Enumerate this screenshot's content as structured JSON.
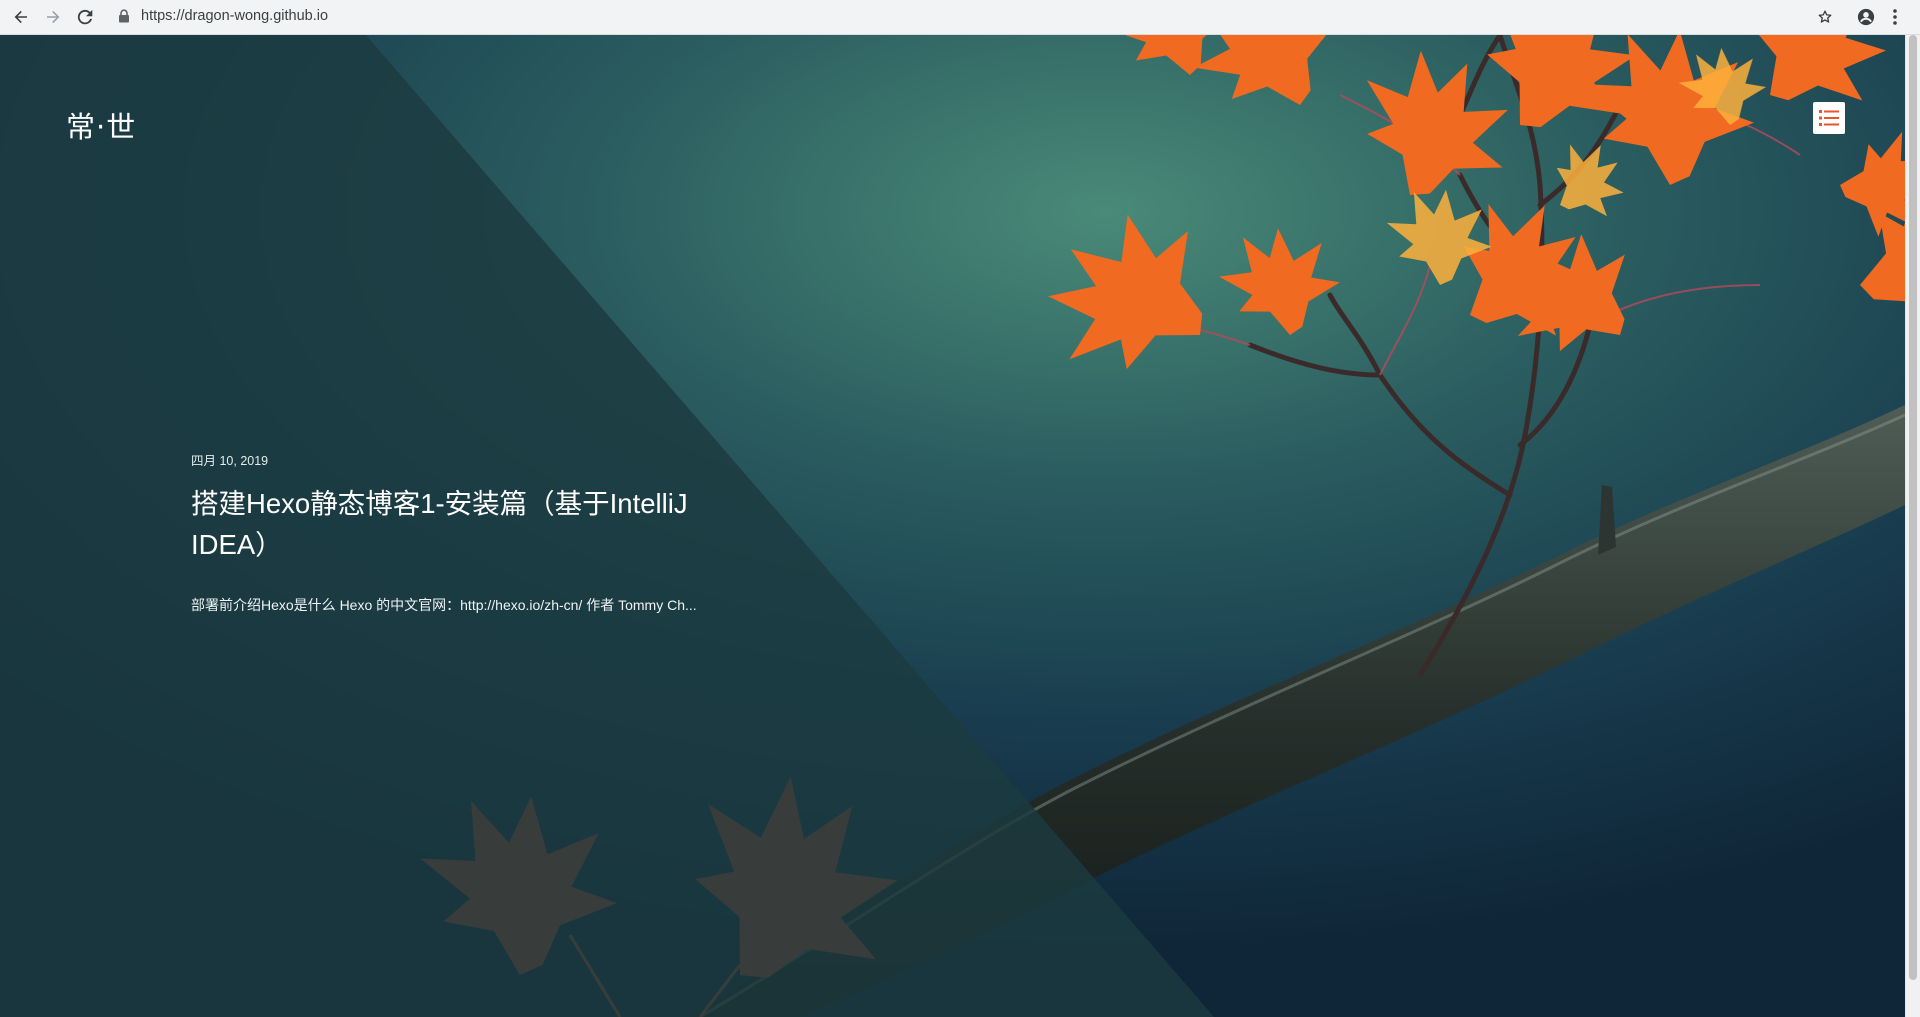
{
  "browser": {
    "url": "https://dragon-wong.github.io",
    "icons": [
      "back-arrow-icon",
      "forward-arrow-icon",
      "reload-icon",
      "lock-icon",
      "bookmark-star-icon",
      "account-icon",
      "kebab-menu-icon"
    ]
  },
  "site": {
    "logo": "常·世",
    "menu_icon": "list-menu-icon",
    "accent_color": "#e8542c"
  },
  "post": {
    "date": "四月 10, 2019",
    "title": "搭建Hexo静态博客1-安装篇（基于IntelliJ IDEA）",
    "excerpt": "部署前介绍Hexo是什么 Hexo 的中文官网：http://hexo.io/zh-cn/ 作者 Tommy Ch..."
  }
}
